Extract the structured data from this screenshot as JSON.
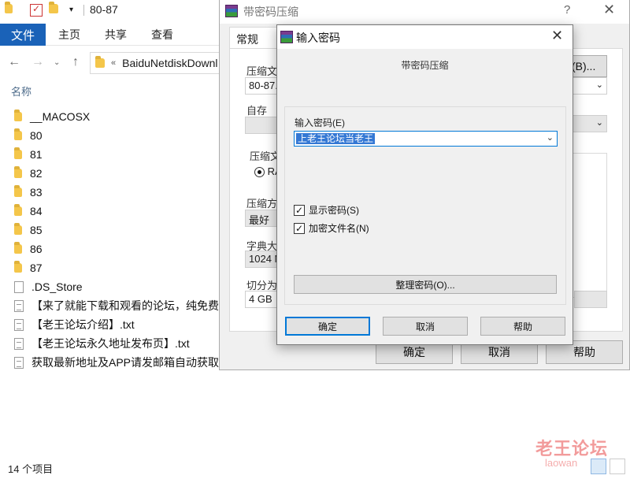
{
  "explorer": {
    "window_title": "80-87",
    "ribbon_tabs": [
      "文件",
      "主页",
      "共享",
      "查看"
    ],
    "address": "BaiduNetdiskDownl",
    "address_prefix": "«",
    "column_header": "名称",
    "files": [
      {
        "name": "__MACOSX",
        "icon": "folder-icon"
      },
      {
        "name": "80",
        "icon": "folder-icon"
      },
      {
        "name": "81",
        "icon": "folder-icon"
      },
      {
        "name": "82",
        "icon": "folder-icon"
      },
      {
        "name": "83",
        "icon": "folder-icon"
      },
      {
        "name": "84",
        "icon": "folder-icon"
      },
      {
        "name": "85",
        "icon": "folder-icon"
      },
      {
        "name": "86",
        "icon": "folder-icon"
      },
      {
        "name": "87",
        "icon": "folder-icon"
      },
      {
        "name": ".DS_Store",
        "icon": "file-icon"
      },
      {
        "name": "【来了就能下载和观看的论坛，纯免费！",
        "icon": "text-file-icon"
      },
      {
        "name": "【老王论坛介绍】.txt",
        "icon": "text-file-icon"
      },
      {
        "name": "【老王论坛永久地址发布页】.txt",
        "icon": "text-file-icon"
      },
      {
        "name": "获取最新地址及APP请发邮箱自动获取.tx",
        "icon": "text-file-icon"
      }
    ],
    "status": "14 个项目"
  },
  "archive_dialog": {
    "title": "带密码压缩",
    "help": "?",
    "close": "✕",
    "tab": "常规",
    "archive_name_label": "压缩文",
    "archive_name_value": "80-87.r",
    "browse_button": "(B)...",
    "profile_label": "自存",
    "format_label": "压缩文",
    "format_value": "RA",
    "method_label": "压缩方",
    "method_value": "最好",
    "dict_label": "字典大",
    "dict_value": "1024 M",
    "split_label": "切分为",
    "split_value": "4 GB",
    "ok": "确定",
    "cancel": "取消",
    "help_button": "帮助"
  },
  "password_dialog": {
    "title": "输入密码",
    "close": "✕",
    "subtitle": "带密码压缩",
    "password_label": "输入密码(E)",
    "password_value": "上老王论坛当老王",
    "show_password": "显示密码(S)",
    "show_password_checked": true,
    "encrypt_names": "加密文件名(N)",
    "encrypt_names_checked": true,
    "organize_button": "整理密码(O)...",
    "ok": "确定",
    "cancel": "取消",
    "help": "帮助"
  },
  "watermark": {
    "text": "老王论坛",
    "sub": "laowan"
  },
  "colors": {
    "file_tab": "#1a62b8",
    "focus_blue": "#0078d7",
    "selection": "#3478d4",
    "folder": "#f4c64a"
  }
}
